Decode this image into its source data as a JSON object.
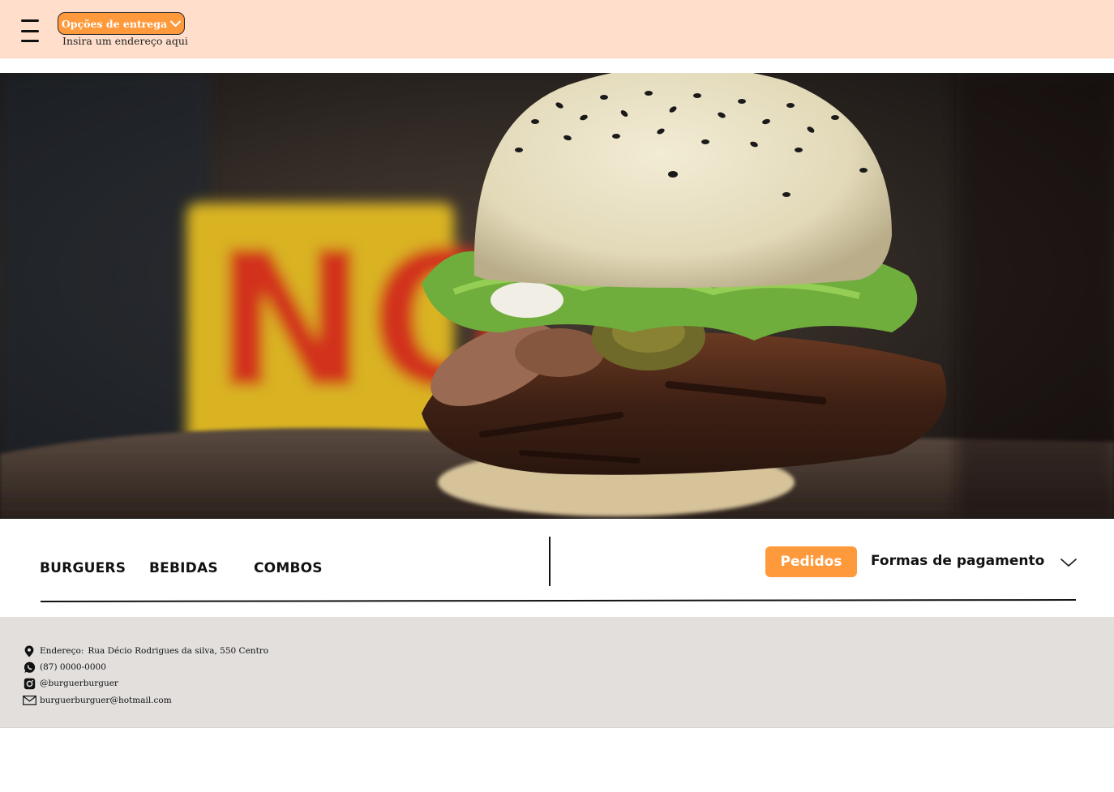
{
  "header": {
    "menu_icon": "hamburger-menu-icon",
    "delivery_button_label": "Opções de entrega",
    "delivery_chevron_icon": "chevron-down-icon",
    "address_prompt": "Insira um endereço aqui",
    "background_color": "#ffdecb"
  },
  "hero": {
    "image_subject": "burger-photo"
  },
  "nav": {
    "items": [
      {
        "label": "BURGUERS"
      },
      {
        "label": "BEBIDAS"
      },
      {
        "label": "COMBOS"
      }
    ],
    "orders_label": "Pedidos",
    "payment_label": "Formas de pagamento",
    "payment_chevron_icon": "chevron-down-icon",
    "accent_color": "#ff9a3c"
  },
  "footer": {
    "address_label": "Endereço:",
    "address_value": "Rua Décio Rodrigues da silva, 550 Centro",
    "phone": "(87) 0000-0000",
    "instagram": "@burguerburguer",
    "email": "burguerburguer@hotmail.com",
    "icons": [
      "location-pin-icon",
      "whatsapp-icon",
      "instagram-icon",
      "mail-icon"
    ],
    "background_color": "#e2dfdd"
  }
}
